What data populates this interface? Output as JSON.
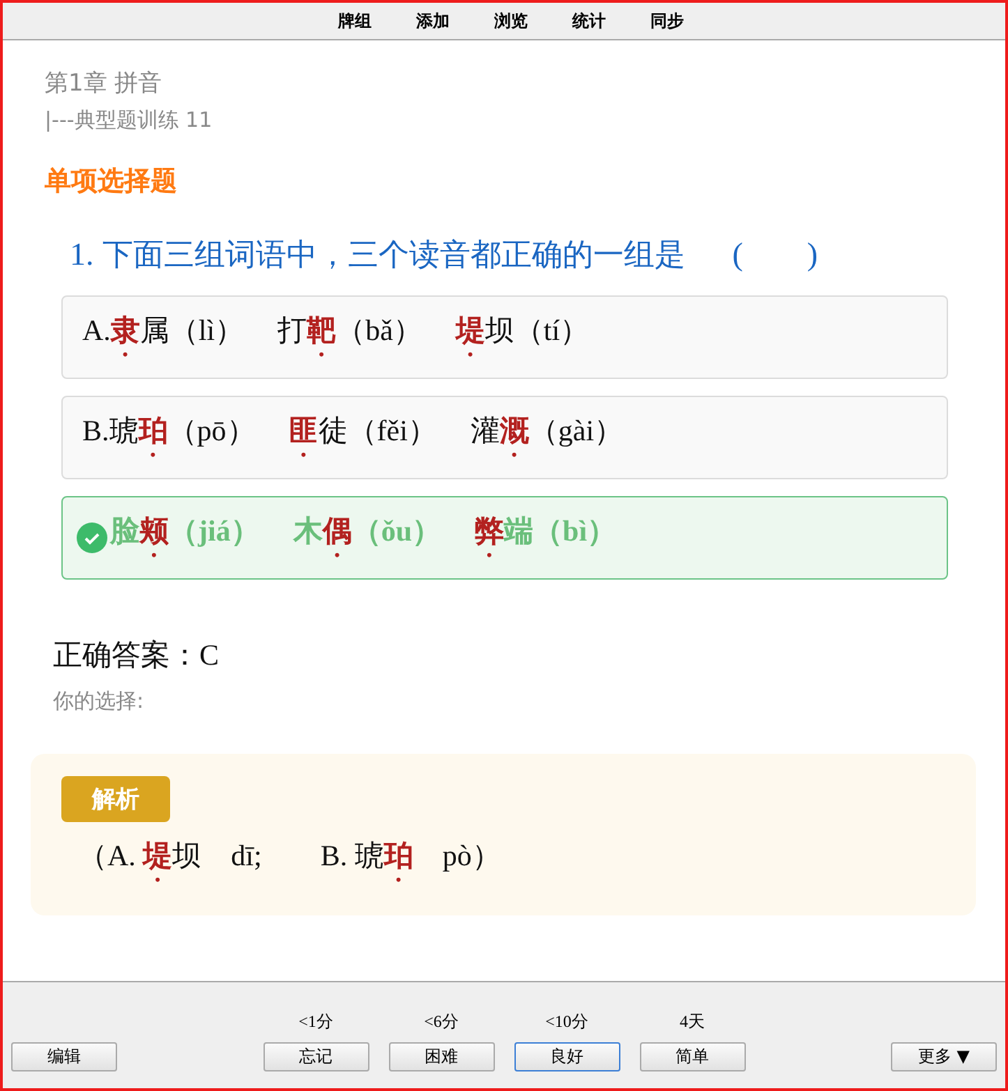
{
  "top_menu": [
    "牌组",
    "添加",
    "浏览",
    "统计",
    "同步"
  ],
  "breadcrumb": {
    "chapter": "第1章 拼音",
    "section": "|---典型题训练 11"
  },
  "section_title": "单项选择题",
  "question": {
    "number": "1.",
    "text": "下面三组词语中，三个读音都正确的一组是",
    "blank": "(　　)"
  },
  "options": [
    {
      "label": "A.",
      "correct": false,
      "words": [
        "**隶**属（lì）",
        "打**靶**（bǎ）",
        "**堤**坝（tí）"
      ]
    },
    {
      "label": "B.",
      "correct": false,
      "words": [
        "琥**珀**（pō）",
        "**匪**徒（fěi）",
        "灌**溉**（gài）"
      ]
    },
    {
      "correct": true,
      "words": [
        "脸**颊**（jiá）",
        "木**偶**（ǒu）",
        "**弊**端（bì）"
      ]
    }
  ],
  "answer": {
    "correct_label": "正确答案：C",
    "your_choice": "你的选择:"
  },
  "explanation": {
    "tag": "解析",
    "text": "（A. **堤**坝　dī;　　B. 琥**珀**　pò）"
  },
  "bottom_bar": {
    "edit": "编辑",
    "more": "更多 ▼",
    "answers": [
      {
        "time": "<1分",
        "label": "忘记",
        "focused": false
      },
      {
        "time": "<6分",
        "label": "困难",
        "focused": false
      },
      {
        "time": "<10分",
        "label": "良好",
        "focused": true
      },
      {
        "time": "4天",
        "label": "简单",
        "focused": false
      }
    ]
  }
}
